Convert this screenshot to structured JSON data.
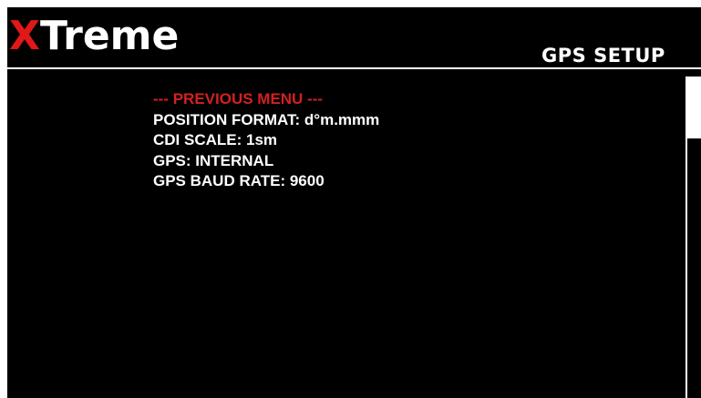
{
  "brand": {
    "logo_first_letter": "X",
    "logo_rest": "Treme",
    "accent_color": "#e01818"
  },
  "header": {
    "title": "GPS SETUP"
  },
  "menu": {
    "items": [
      {
        "label": "--- PREVIOUS MENU ---",
        "kind": "previous"
      },
      {
        "label": "POSITION FORMAT: d°m.mmm",
        "kind": "setting"
      },
      {
        "label": "CDI SCALE: 1sm",
        "kind": "setting"
      },
      {
        "label": "GPS: INTERNAL",
        "kind": "setting"
      },
      {
        "label": "GPS BAUD RATE: 9600",
        "kind": "setting"
      }
    ]
  },
  "scrollbar": {
    "position_fraction": 0.0
  }
}
